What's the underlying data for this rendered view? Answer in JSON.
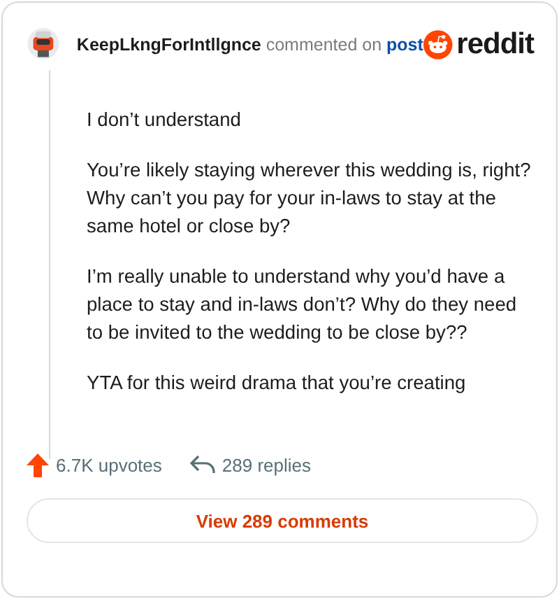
{
  "header": {
    "username": "KeepLkngForIntllgnce",
    "action": "commented on",
    "link": "post",
    "brand": "reddit"
  },
  "paragraphs": [
    "I don’t understand",
    "You’re likely staying wherever this wedding is, right? Why can’t you pay for your in-laws to stay at the same hotel or close by?",
    "I’m really unable to understand why you’d have a place to stay and in-laws don’t? Why do they need to be invited to the wedding to be close by??",
    "YTA for this weird drama that you’re creating"
  ],
  "stats": {
    "upvotes": "6.7K upvotes",
    "replies": "289 replies"
  },
  "button": "View 289 comments"
}
